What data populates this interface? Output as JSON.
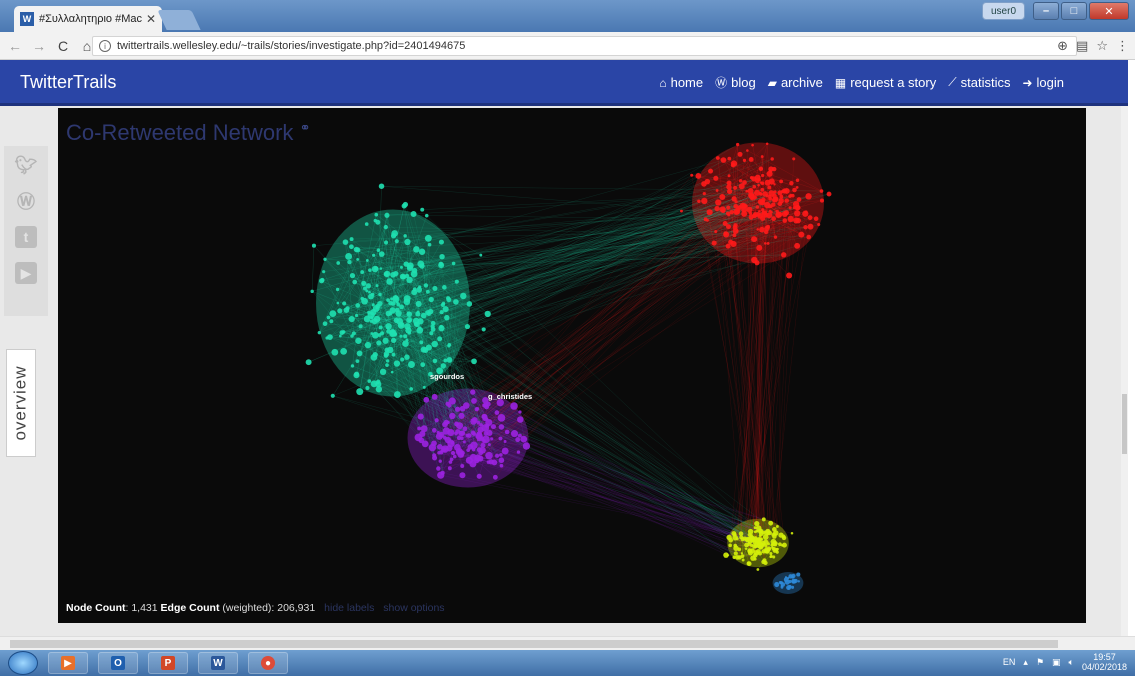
{
  "browser": {
    "tab_title": "#Συλλαλητηριο #Maced",
    "tab_favicon": "W",
    "url": "twittertrails.wellesley.edu/~trails/stories/investigate.php?id=2401494675",
    "user_badge": "user0"
  },
  "site": {
    "brand": "TwitterTrails",
    "nav": [
      {
        "label": "home",
        "icon": "home-icon"
      },
      {
        "label": "blog",
        "icon": "wordpress-icon"
      },
      {
        "label": "archive",
        "icon": "folder-open-icon"
      },
      {
        "label": "request a story",
        "icon": "newspaper-icon"
      },
      {
        "label": "statistics",
        "icon": "line-chart-icon"
      },
      {
        "label": "login",
        "icon": "sign-in-icon"
      }
    ]
  },
  "sidebar": {
    "social_icons": [
      "twitter-icon",
      "wordpress-icon",
      "tumblr-icon",
      "youtube-icon"
    ],
    "overview_label": "overview"
  },
  "graph": {
    "title": "Co-Retweeted Network",
    "node_labels": [
      "sgourdos",
      "g_christides"
    ],
    "footer": {
      "node_count_label": "Node Count",
      "node_count": ": 1,431",
      "edge_count_label": "Edge Count",
      "edge_count": "(weighted): 206,931",
      "hide_labels": "hide labels",
      "show_options": "show options"
    },
    "cluster_colors": {
      "teal": "#1fe0b0",
      "red": "#ff1a1a",
      "purple": "#9b22e0",
      "yellow": "#d4f00a",
      "blue": "#2e8ad8"
    }
  },
  "taskbar": {
    "apps": [
      "media-player-icon",
      "outlook-icon",
      "powerpoint-icon",
      "word-icon",
      "chrome-icon"
    ],
    "tray_lang": "EN",
    "time": "19:57",
    "date": "04/02/2018"
  }
}
